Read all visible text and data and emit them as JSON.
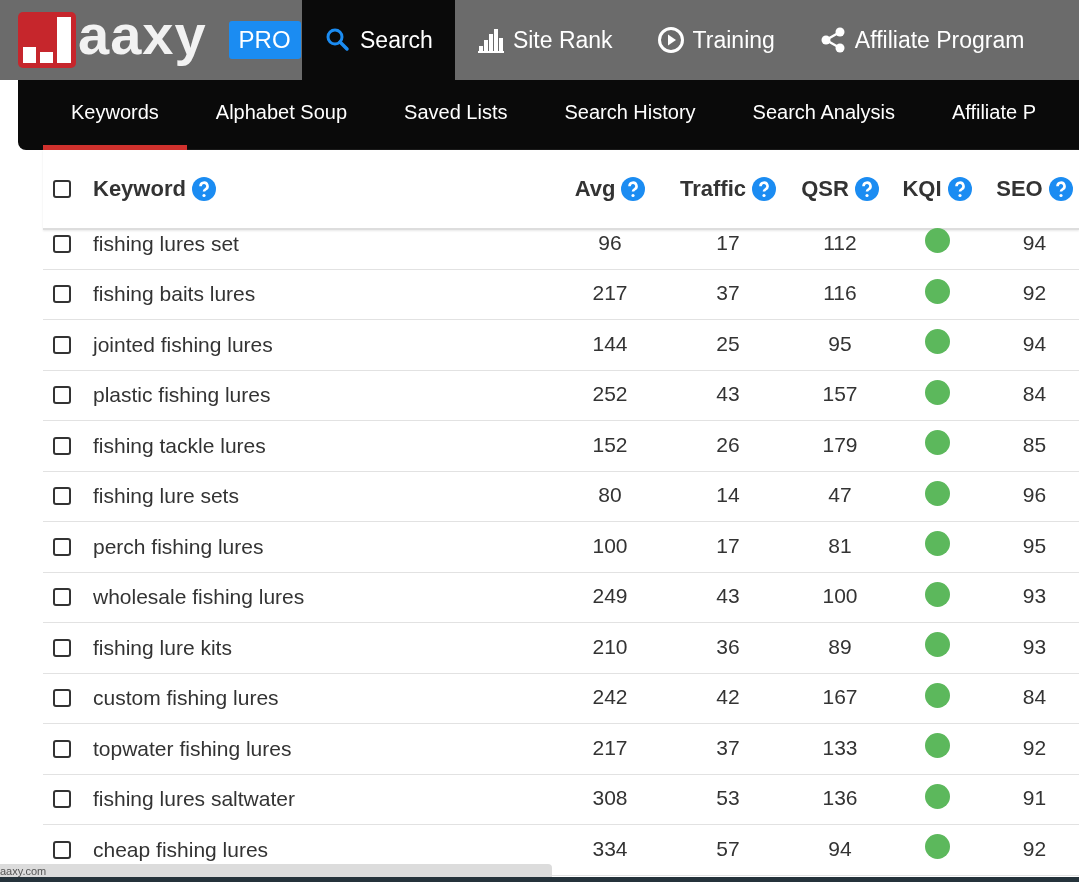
{
  "logo": {
    "text": "aaxy",
    "badge": "PRO"
  },
  "main_nav": [
    {
      "label": "Search",
      "selected": true
    },
    {
      "label": "Site Rank",
      "selected": false
    },
    {
      "label": "Training",
      "selected": false
    },
    {
      "label": "Affiliate Program",
      "selected": false
    }
  ],
  "sub_nav": [
    {
      "label": "Keywords",
      "selected": true
    },
    {
      "label": "Alphabet Soup",
      "selected": false
    },
    {
      "label": "Saved Lists",
      "selected": false
    },
    {
      "label": "Search History",
      "selected": false
    },
    {
      "label": "Search Analysis",
      "selected": false
    },
    {
      "label": "Affiliate P",
      "selected": false
    }
  ],
  "table": {
    "select_all": {
      "checked": false
    },
    "columns": [
      "Keyword",
      "Avg",
      "Traffic",
      "QSR",
      "KQI",
      "SEO"
    ],
    "rows": [
      {
        "checked": false,
        "keyword": "fishing lures set",
        "avg": "96",
        "traffic": "17",
        "qsr": "112",
        "seo": "94"
      },
      {
        "checked": false,
        "keyword": "fishing baits lures",
        "avg": "217",
        "traffic": "37",
        "qsr": "116",
        "seo": "92"
      },
      {
        "checked": false,
        "keyword": "jointed fishing lures",
        "avg": "144",
        "traffic": "25",
        "qsr": "95",
        "seo": "94"
      },
      {
        "checked": false,
        "keyword": "plastic fishing lures",
        "avg": "252",
        "traffic": "43",
        "qsr": "157",
        "seo": "84"
      },
      {
        "checked": false,
        "keyword": "fishing tackle lures",
        "avg": "152",
        "traffic": "26",
        "qsr": "179",
        "seo": "85"
      },
      {
        "checked": false,
        "keyword": "fishing lure sets",
        "avg": "80",
        "traffic": "14",
        "qsr": "47",
        "seo": "96"
      },
      {
        "checked": false,
        "keyword": "perch fishing lures",
        "avg": "100",
        "traffic": "17",
        "qsr": "81",
        "seo": "95"
      },
      {
        "checked": false,
        "keyword": "wholesale fishing lures",
        "avg": "249",
        "traffic": "43",
        "qsr": "100",
        "seo": "93"
      },
      {
        "checked": false,
        "keyword": "fishing lure kits",
        "avg": "210",
        "traffic": "36",
        "qsr": "89",
        "seo": "93"
      },
      {
        "checked": false,
        "keyword": "custom fishing lures",
        "avg": "242",
        "traffic": "42",
        "qsr": "167",
        "seo": "84"
      },
      {
        "checked": false,
        "keyword": "topwater fishing lures",
        "avg": "217",
        "traffic": "37",
        "qsr": "133",
        "seo": "92"
      },
      {
        "checked": false,
        "keyword": "fishing lures saltwater",
        "avg": "308",
        "traffic": "53",
        "qsr": "136",
        "seo": "91"
      },
      {
        "checked": false,
        "keyword": "cheap fishing lures",
        "avg": "334",
        "traffic": "57",
        "qsr": "94",
        "seo": "92"
      }
    ]
  },
  "status_bar": {
    "url": "aaxy.com"
  }
}
